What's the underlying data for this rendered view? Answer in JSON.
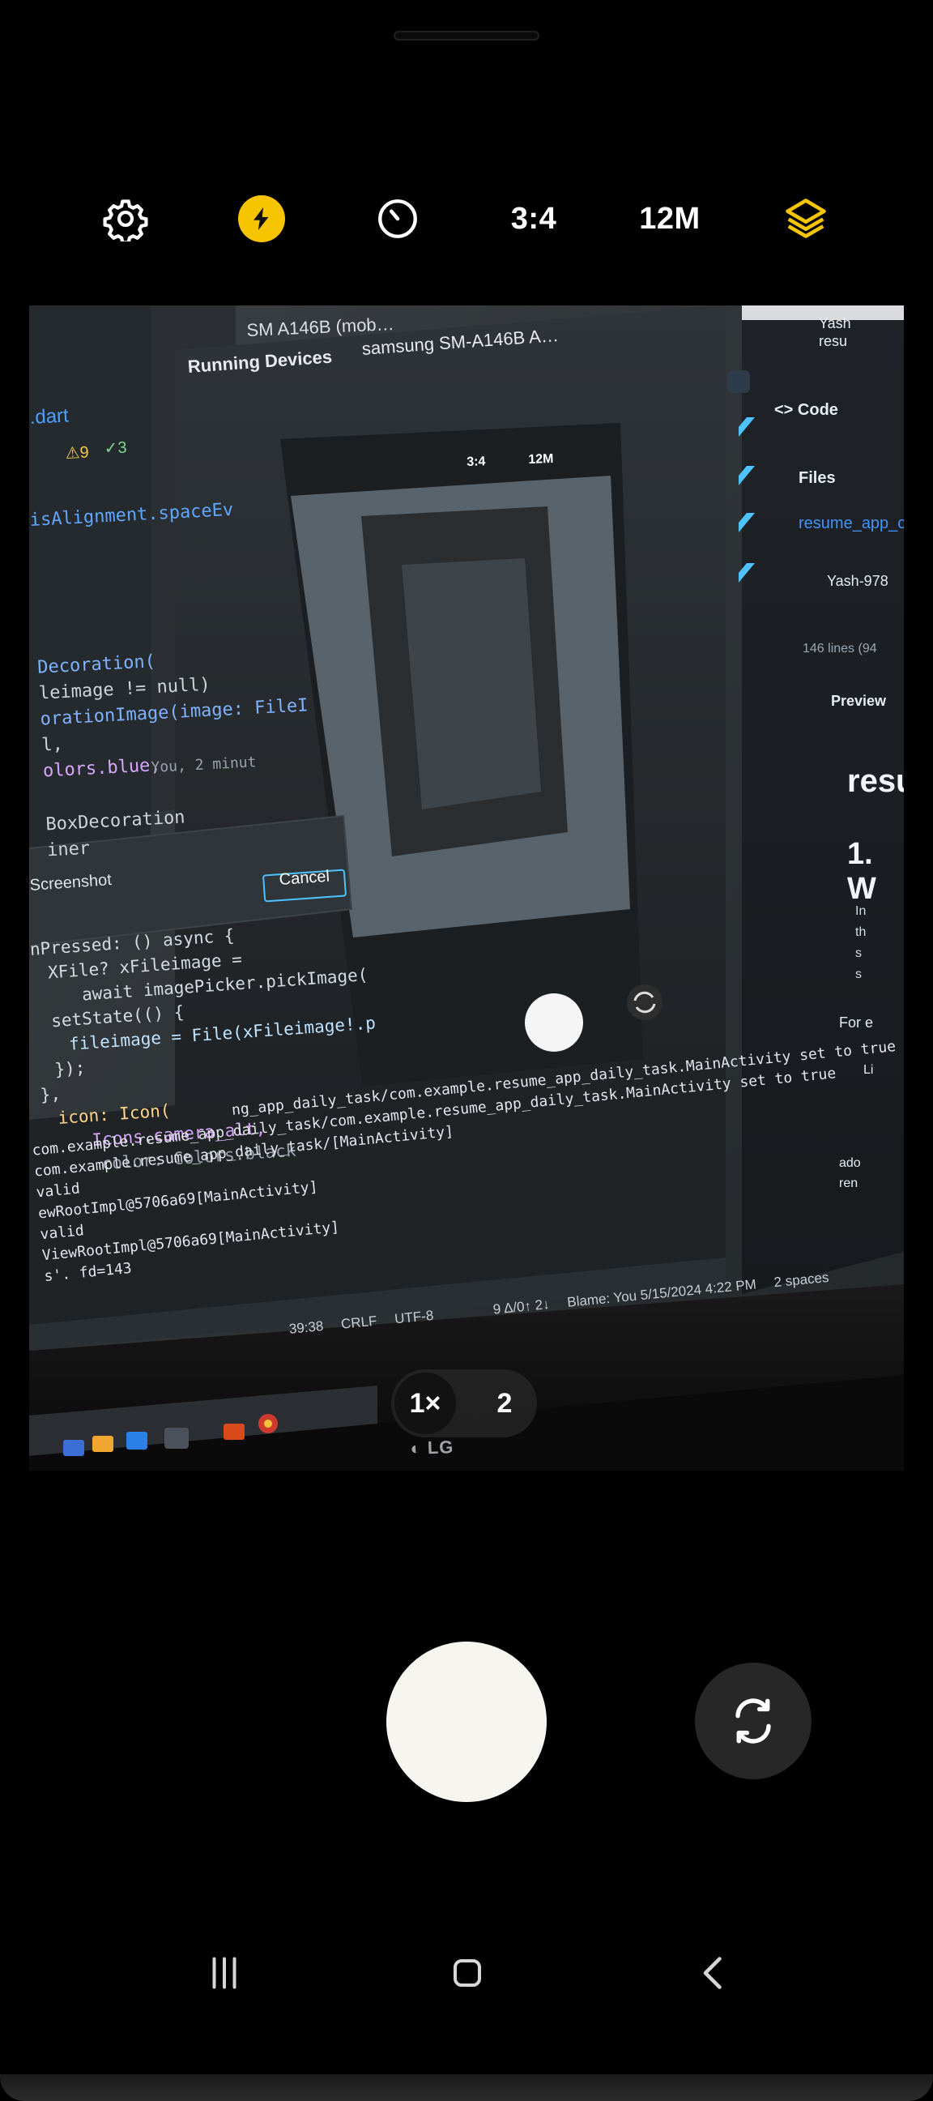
{
  "camera": {
    "top_toolbar": {
      "aspect_ratio": "3:4",
      "megapixels": "12M",
      "icons": [
        "gear-icon",
        "flash-icon",
        "timer-icon",
        "layers-icon"
      ],
      "accent_yellow": "#f6c400"
    },
    "zoom": {
      "primary": "1×",
      "secondary": "2"
    },
    "controls": {
      "shutter": "shutter-button",
      "flip": "switch-camera-button"
    },
    "nav": {
      "icons": [
        "recent-apps-icon",
        "home-icon",
        "back-icon"
      ]
    }
  },
  "viewfinder_scene": {
    "ide": {
      "debug_device": "SM A146B (mob…",
      "running_devices_label": "Running Devices",
      "tab_label": "samsung SM-A146B A…",
      "filename": ".dart",
      "warnings": "9",
      "checks": "3",
      "code_lines": [
        "isAlignment.spaceEv",
        "Decoration(",
        "leimage != null)",
        "orationImage(image: FileI",
        "l,",
        "olors.blue,",
        "BoxDecoration",
        "iner",
        "nPressed: () async {",
        "XFile? xFileimage =",
        "await imagePicker.pickImage(",
        "setState(() {",
        "fileimage = File(xFileimage!.p",
        "});",
        "},",
        "icon: Icon(",
        "Icons.camera_alt,",
        "color: Colors.black"
      ],
      "blame_inline": "You, 2 minut",
      "dialog_title": "Screenshot",
      "dialog_cancel": "Cancel",
      "console_lines": [
        "ng_app_daily_task/com.example.resume_app_daily_task.MainActivity set to true",
        "com.example.resume_app_daily_task/com.example.resume_app_daily_task.MainActivity set to true",
        "com.example.resume_app_daily_task/[MainActivity]",
        "valid",
        "ewRootImpl@5706a69[MainActivity]",
        "valid",
        "ViewRootImpl@5706a69[MainActivity]",
        "s'. fd=143"
      ],
      "status_bar": {
        "position": "39:38",
        "line_ending": "CRLF",
        "encoding": "UTF-8",
        "blame": "Blame: You 5/15/2024 4:22 PM",
        "indent": "2 spaces",
        "vcs": "9 Δ/0↑ 2↓"
      }
    },
    "mirrored_phone": {
      "aspect_ratio": "3:4",
      "megapixels": "12M"
    },
    "github": {
      "user": "Yash",
      "sub": "resu",
      "code_tab": "Code",
      "files_link": "Files",
      "repo_link": "resume_app_c",
      "author": "Yash-978",
      "lines_info": "146 lines (94",
      "preview_tab": "Preview",
      "heading": "resu",
      "section": "1. W",
      "body_snippets": [
        "In",
        "th",
        "s",
        "s"
      ],
      "for_text": "For e",
      "li_text": "Li",
      "ado_text": "ado",
      "ren_text": "ren"
    },
    "brand": "LG"
  }
}
